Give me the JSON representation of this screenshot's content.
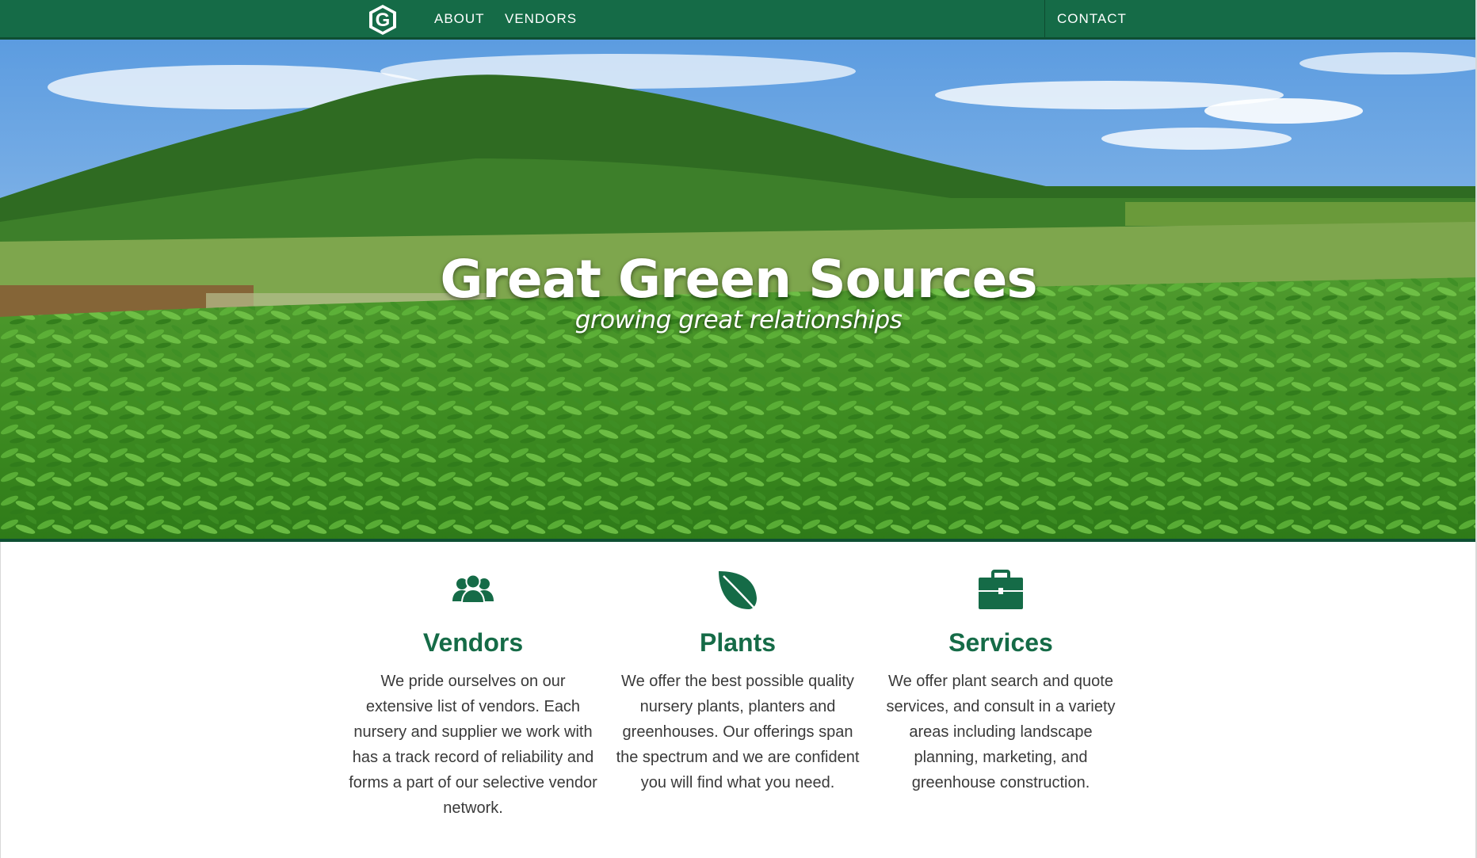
{
  "nav": {
    "logo_letter": "G",
    "about_label": "ABOUT",
    "vendors_label": "VENDORS",
    "contact_label": "CONTACT"
  },
  "hero": {
    "title": "Great Green Sources",
    "subtitle": "growing great relationships"
  },
  "features": {
    "vendors": {
      "icon": "people-icon",
      "title": "Vendors",
      "text": "We pride ourselves on our extensive list of vendors. Each nursery and supplier we work with has a track record of reliability and forms a part of our selective vendor network."
    },
    "plants": {
      "icon": "leaf-icon",
      "title": "Plants",
      "text": "We offer the best possible quality nursery plants, planters and greenhouses. Our offerings span the spectrum and we are confident you will find what you need."
    },
    "services": {
      "icon": "briefcase-icon",
      "title": "Services",
      "text": "We offer plant search and quote services, and consult in a variety areas including landscape planning, marketing, and greenhouse construction."
    }
  },
  "colors": {
    "brand_green": "#156b47",
    "brand_dark": "#0e4f33",
    "text": "#3a3a3a"
  }
}
